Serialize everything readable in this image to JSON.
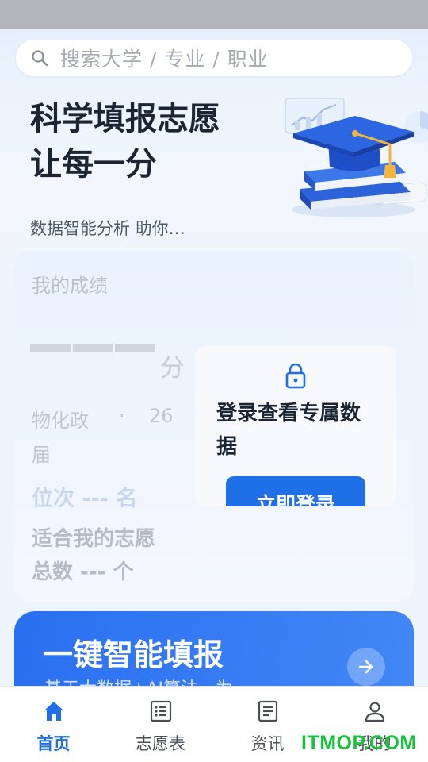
{
  "search": {
    "placeholder": "搜索大学 / 专业 / 职业"
  },
  "hero": {
    "title": "科学填报志愿 让每一分",
    "subtitle": "数据智能分析  助你…"
  },
  "score_card": {
    "label": "我的成绩",
    "unit": "分",
    "subjects": "物化政",
    "dot": "·",
    "year": "26",
    "session": "届",
    "rank": "位次 --- 名",
    "match_line1": "适合我的志愿",
    "match_line2": "总数  ---  个"
  },
  "login_panel": {
    "prompt": "登录查看专属数据",
    "button_label": "立即登录"
  },
  "smart_fill": {
    "title": "一键智能填报",
    "description": "基于大数据+AI算法，为"
  },
  "tabs": [
    {
      "label": "首页",
      "icon": "home-icon",
      "active": true
    },
    {
      "label": "志愿表",
      "icon": "list-icon",
      "active": false
    },
    {
      "label": "资讯",
      "icon": "news-icon",
      "active": false
    },
    {
      "label": "我的",
      "icon": "user-icon",
      "active": false
    }
  ],
  "colors": {
    "accent": "#1f6fe6",
    "card_gradient_start": "#2a6ff0",
    "card_gradient_end": "#4287f5"
  },
  "watermark": "ITMOP.COM"
}
